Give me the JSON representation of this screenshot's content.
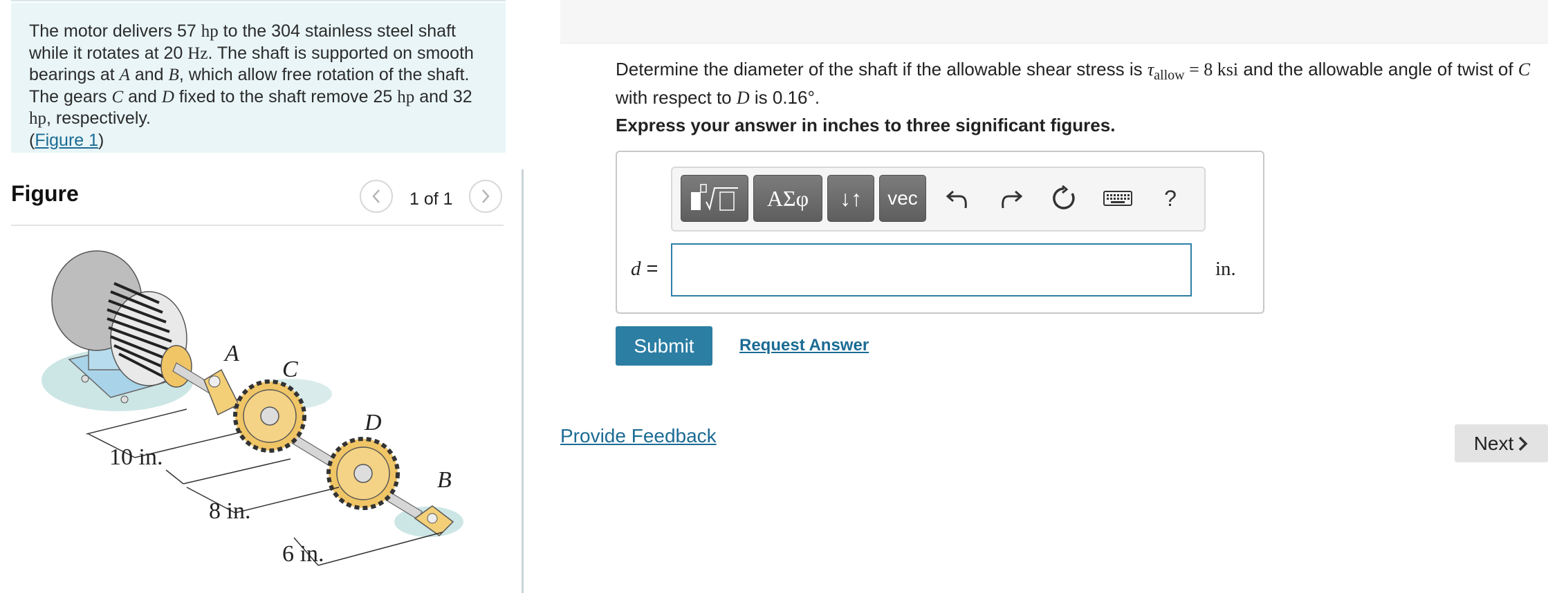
{
  "problem": {
    "s1": "The motor delivers 57 ",
    "hp": "hp",
    "s2": " to the 304 stainless steel shaft while it rotates at 20 ",
    "hz": "Hz",
    "s3": ". The shaft is supported on smooth bearings at ",
    "a": "A",
    "s4": " and ",
    "b": "B",
    "s5": ", which allow free rotation of the shaft. The gears ",
    "c": "C",
    "s6": " and ",
    "d": "D",
    "s7": " fixed to the shaft remove 25 ",
    "s8": " and 32 ",
    "s9": ", respectively.",
    "fig_open": "(",
    "fig_link": "Figure 1",
    "fig_close": ")"
  },
  "figure": {
    "heading": "Figure",
    "counter": "1 of 1",
    "labels": {
      "a": "A",
      "b": "B",
      "c": "C",
      "d": "D"
    },
    "dims": {
      "d1": "10 in.",
      "d2": "8 in.",
      "d3": "6 in."
    }
  },
  "question": {
    "s1": "Determine the diameter of the shaft if the allowable shear stress is ",
    "tau": "τ",
    "sub": "allow",
    "eq": " = 8 ",
    "ksi": "ksi",
    "s2": " and the allowable angle of twist of ",
    "c": "C",
    "s3": " with respect to ",
    "d": "D",
    "s4": " is 0.16°."
  },
  "instruction": "Express your answer in inches to three significant figures.",
  "toolbar": {
    "greek_label": "ΑΣφ",
    "arrows_label": "↓↑",
    "vec_label": "vec",
    "help_label": "?"
  },
  "answer": {
    "var": "d",
    "eq": " =",
    "value": "",
    "unit": "in."
  },
  "actions": {
    "submit": "Submit",
    "request": "Request Answer",
    "feedback": "Provide Feedback",
    "next": "Next"
  },
  "colors": {
    "accent": "#2c7ea3",
    "link": "#1b6b94",
    "problem_bg": "#e9f5f7"
  }
}
